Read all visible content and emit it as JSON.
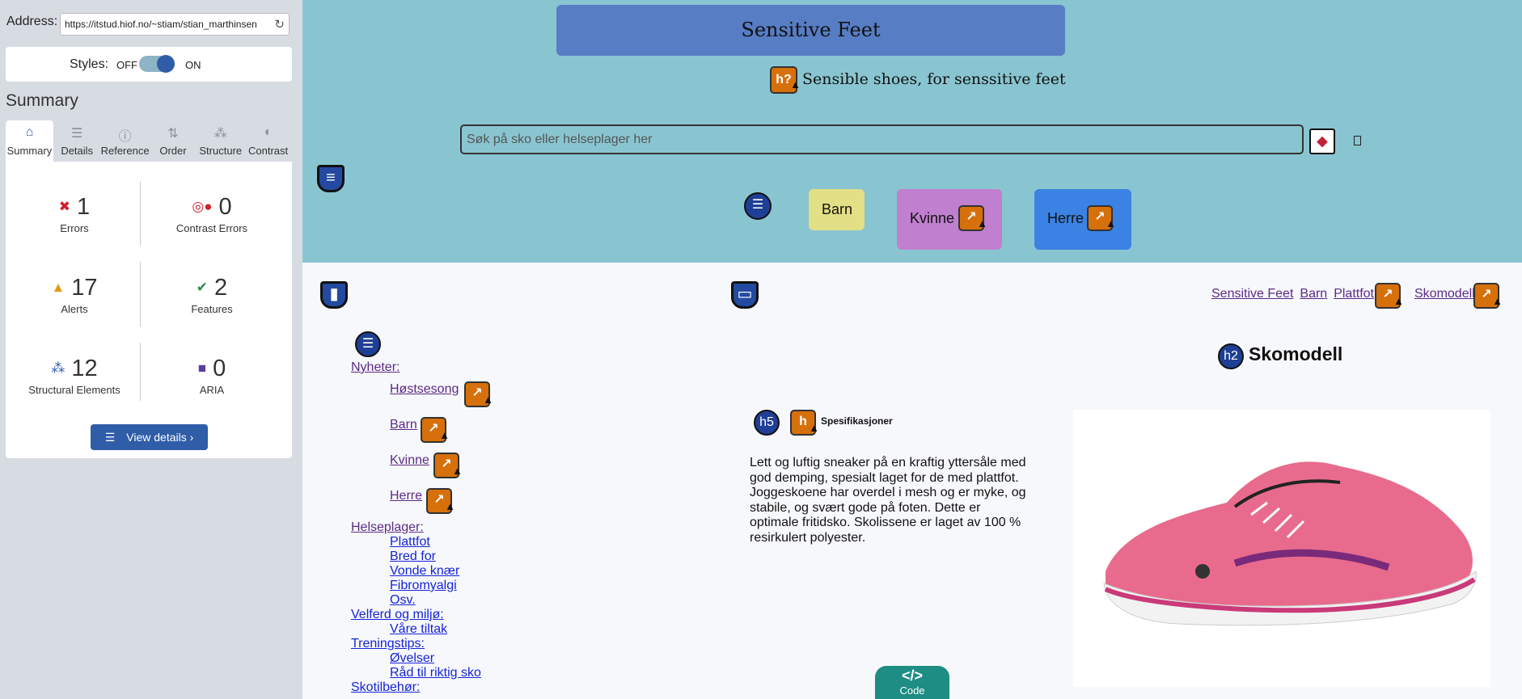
{
  "wave": {
    "address_label": "Address:",
    "address_value": "https://itstud.hiof.no/~stiam/stian_marthinsen",
    "styles_label": "Styles:",
    "styles_off": "OFF",
    "styles_on": "ON",
    "summary_title": "Summary",
    "tabs": [
      {
        "label": "Summary",
        "icon": "home-icon"
      },
      {
        "label": "Details",
        "icon": "list-icon"
      },
      {
        "label": "Reference",
        "icon": "info-icon"
      },
      {
        "label": "Order",
        "icon": "order-icon"
      },
      {
        "label": "Structure",
        "icon": "structure-icon"
      },
      {
        "label": "Contrast",
        "icon": "contrast-icon"
      }
    ],
    "stats": [
      {
        "icon": "error-icon",
        "value": "1",
        "label": "Errors",
        "color": "#d0202e"
      },
      {
        "icon": "contrast-error-icon",
        "value": "0",
        "label": "Contrast Errors",
        "color": "#d0202e"
      },
      {
        "icon": "alert-icon",
        "value": "17",
        "label": "Alerts",
        "color": "#e09a14"
      },
      {
        "icon": "feature-icon",
        "value": "2",
        "label": "Features",
        "color": "#2e8a4a"
      },
      {
        "icon": "structure-icon",
        "value": "12",
        "label": "Structural Elements",
        "color": "#2f5da8"
      },
      {
        "icon": "aria-icon",
        "value": "0",
        "label": "ARIA",
        "color": "#5a3e9c"
      }
    ],
    "view_details": "View details ›"
  },
  "site": {
    "brand": "Sensitive Feet",
    "tagline": "Sensible shoes, for senssitive feet",
    "search_placeholder": "Søk på sko eller helseplager her",
    "nav": [
      "Barn",
      "Kvinne",
      "Herre"
    ],
    "breadcrumbs": [
      "Sensitive Feet",
      "Barn",
      "Plattfot",
      "Skomodell"
    ],
    "menu": [
      {
        "label": "Nyheter:",
        "children": [
          "Høstsesong",
          "Barn",
          "Kvinne",
          "Herre"
        ]
      },
      {
        "label": "Helseplager:",
        "children": [
          "Plattfot",
          "Bred for",
          "Vonde knær",
          "Fibromyalgi",
          "Osv."
        ]
      },
      {
        "label": "Velferd og miljø:",
        "children": [
          "Våre tiltak"
        ]
      },
      {
        "label": "Treningstips:",
        "children": [
          "Øvelser",
          "Råd til riktig sko"
        ]
      },
      {
        "label": "Skotilbehør:",
        "children": []
      }
    ],
    "heading": "Skomodell",
    "h2_badge": "h2",
    "h5_badge": "h5",
    "h_badge": "h?",
    "spec_title": "Spesifikasjoner",
    "description": "Lett og luftig sneaker på en kraftig yttersåle med god demping, spesialt laget for de med plattfot. Joggeskoene har overdel i mesh og er myke, og stabile, og svært gode på foten. Dette er optimale fritidsko. Skolissene er laget av 100 % resirkulert polyester.",
    "code_label": "Code",
    "colors": {
      "header": "#89c5d1",
      "brand": "#577dc4",
      "barn": "#e3df86",
      "kvinne": "#c07fcf",
      "herre": "#3a82e3"
    }
  }
}
